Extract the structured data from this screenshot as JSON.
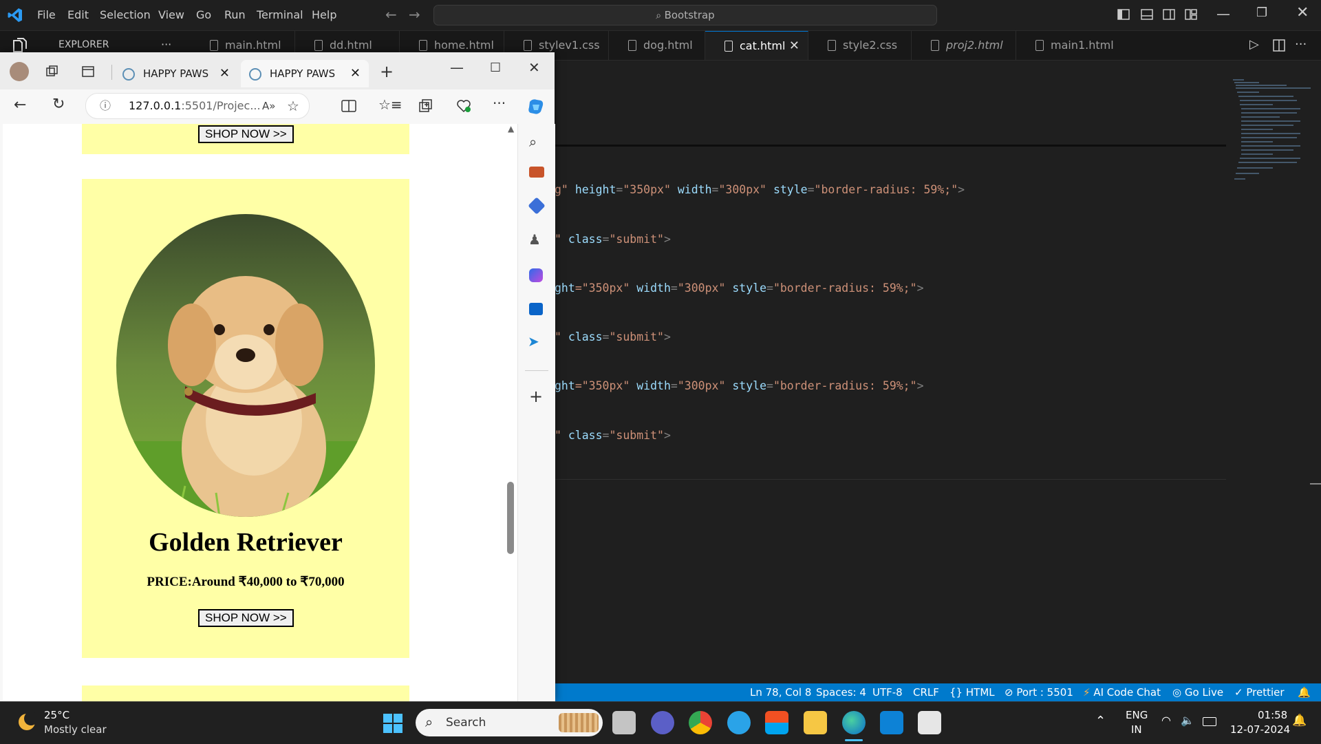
{
  "vscode": {
    "menu": [
      "File",
      "Edit",
      "Selection",
      "View",
      "Go",
      "Run",
      "Terminal",
      "Help"
    ],
    "command_center": "Bootstrap",
    "explorer_label": "EXPLORER",
    "explorer_more": "···",
    "tabs": [
      {
        "label": "main.html"
      },
      {
        "label": "dd.html"
      },
      {
        "label": "home.html"
      },
      {
        "label": "stylev1.css"
      },
      {
        "label": "dog.html"
      },
      {
        "label": "cat.html",
        "active": true
      },
      {
        "label": "style2.css"
      },
      {
        "label": "proj2.html"
      },
      {
        "label": "main1.html"
      }
    ],
    "code_lines": [
      {
        "pre": "g\"",
        "a1": "height",
        "v1": "\"350px\"",
        "a2": "width",
        "v2": "\"300px\"",
        "a3": "style",
        "v3": "\"border-radius: 59%;\"",
        "end": ">"
      },
      {
        "pre": "\"",
        "a1": "class",
        "v1": "\"submit\"",
        "end": ">"
      },
      {
        "pre": "ght",
        "v0": "=\"350px\"",
        "a2": "width",
        "v2": "\"300px\"",
        "a3": "style",
        "v3": "\"border-radius: 59%;\"",
        "end": ">"
      },
      {
        "pre": "\"",
        "a1": "class",
        "v1": "\"submit\"",
        "end": ">"
      },
      {
        "pre": "ght",
        "v0": "=\"350px\"",
        "a2": "width",
        "v2": "\"300px\"",
        "a3": "style",
        "v3": "\"border-radius: 59%;\"",
        "end": ">"
      },
      {
        "pre": "\"",
        "a1": "class",
        "v1": "\"submit\"",
        "end": ">"
      }
    ],
    "status": {
      "position": "Ln 78, Col 8",
      "spaces": "Spaces: 4",
      "encoding": "UTF-8",
      "eol": "CRLF",
      "language": "HTML",
      "port": "Port : 5501",
      "ai": "AI Code Chat",
      "golive": "Go Live",
      "prettier": "Prettier"
    }
  },
  "browser": {
    "tabs": [
      {
        "label": "HAPPY PAWS"
      },
      {
        "label": "HAPPY PAWS",
        "active": true
      }
    ],
    "url_host": "127.0.0.1",
    "url_rest": ":5501/Projec...",
    "page": {
      "shop_label": "SHOP NOW >>",
      "dog_name": "Golden Retriever",
      "price": "PRICE:Around ₹40,000 to ₹70,000"
    }
  },
  "taskbar": {
    "temp": "25°C",
    "weather": "Mostly clear",
    "search": "Search",
    "lang1": "ENG",
    "lang2": "IN",
    "time": "01:58",
    "date": "12-07-2024"
  },
  "colors": {
    "statusbar": "#007acc",
    "card": "#ffffa6",
    "editor_bg": "#1f1f1f"
  }
}
